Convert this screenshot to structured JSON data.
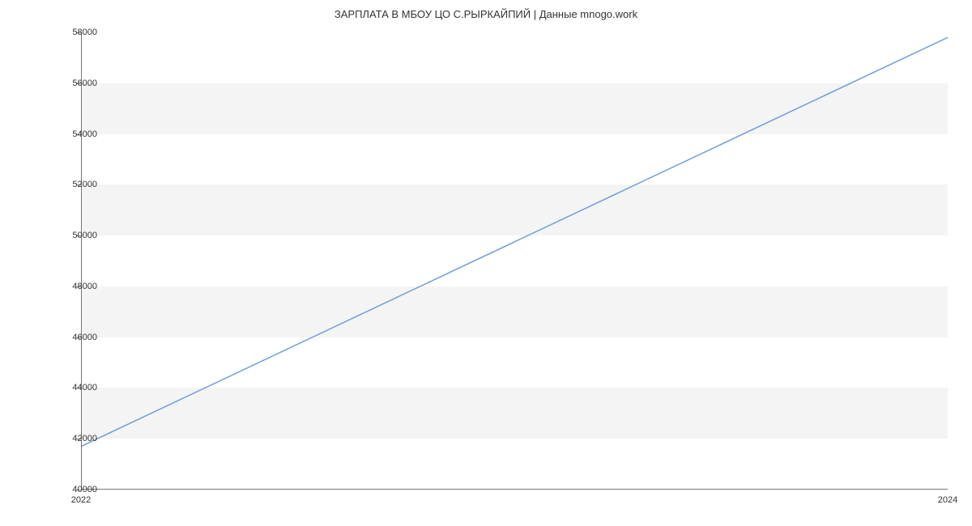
{
  "chart_data": {
    "type": "line",
    "title": "ЗАРПЛАТА В МБОУ ЦО С.РЫРКАЙПИЙ | Данные mnogo.work",
    "x": [
      2022,
      2024
    ],
    "values": [
      41700,
      57800
    ],
    "xlabel": "",
    "ylabel": "",
    "xlim": [
      2022,
      2024
    ],
    "ylim": [
      40000,
      58000
    ],
    "x_ticks": [
      2022,
      2024
    ],
    "y_ticks": [
      40000,
      42000,
      44000,
      46000,
      48000,
      50000,
      52000,
      54000,
      56000,
      58000
    ],
    "line_color": "#6f9fd8",
    "band_color": "#f4f4f4"
  }
}
